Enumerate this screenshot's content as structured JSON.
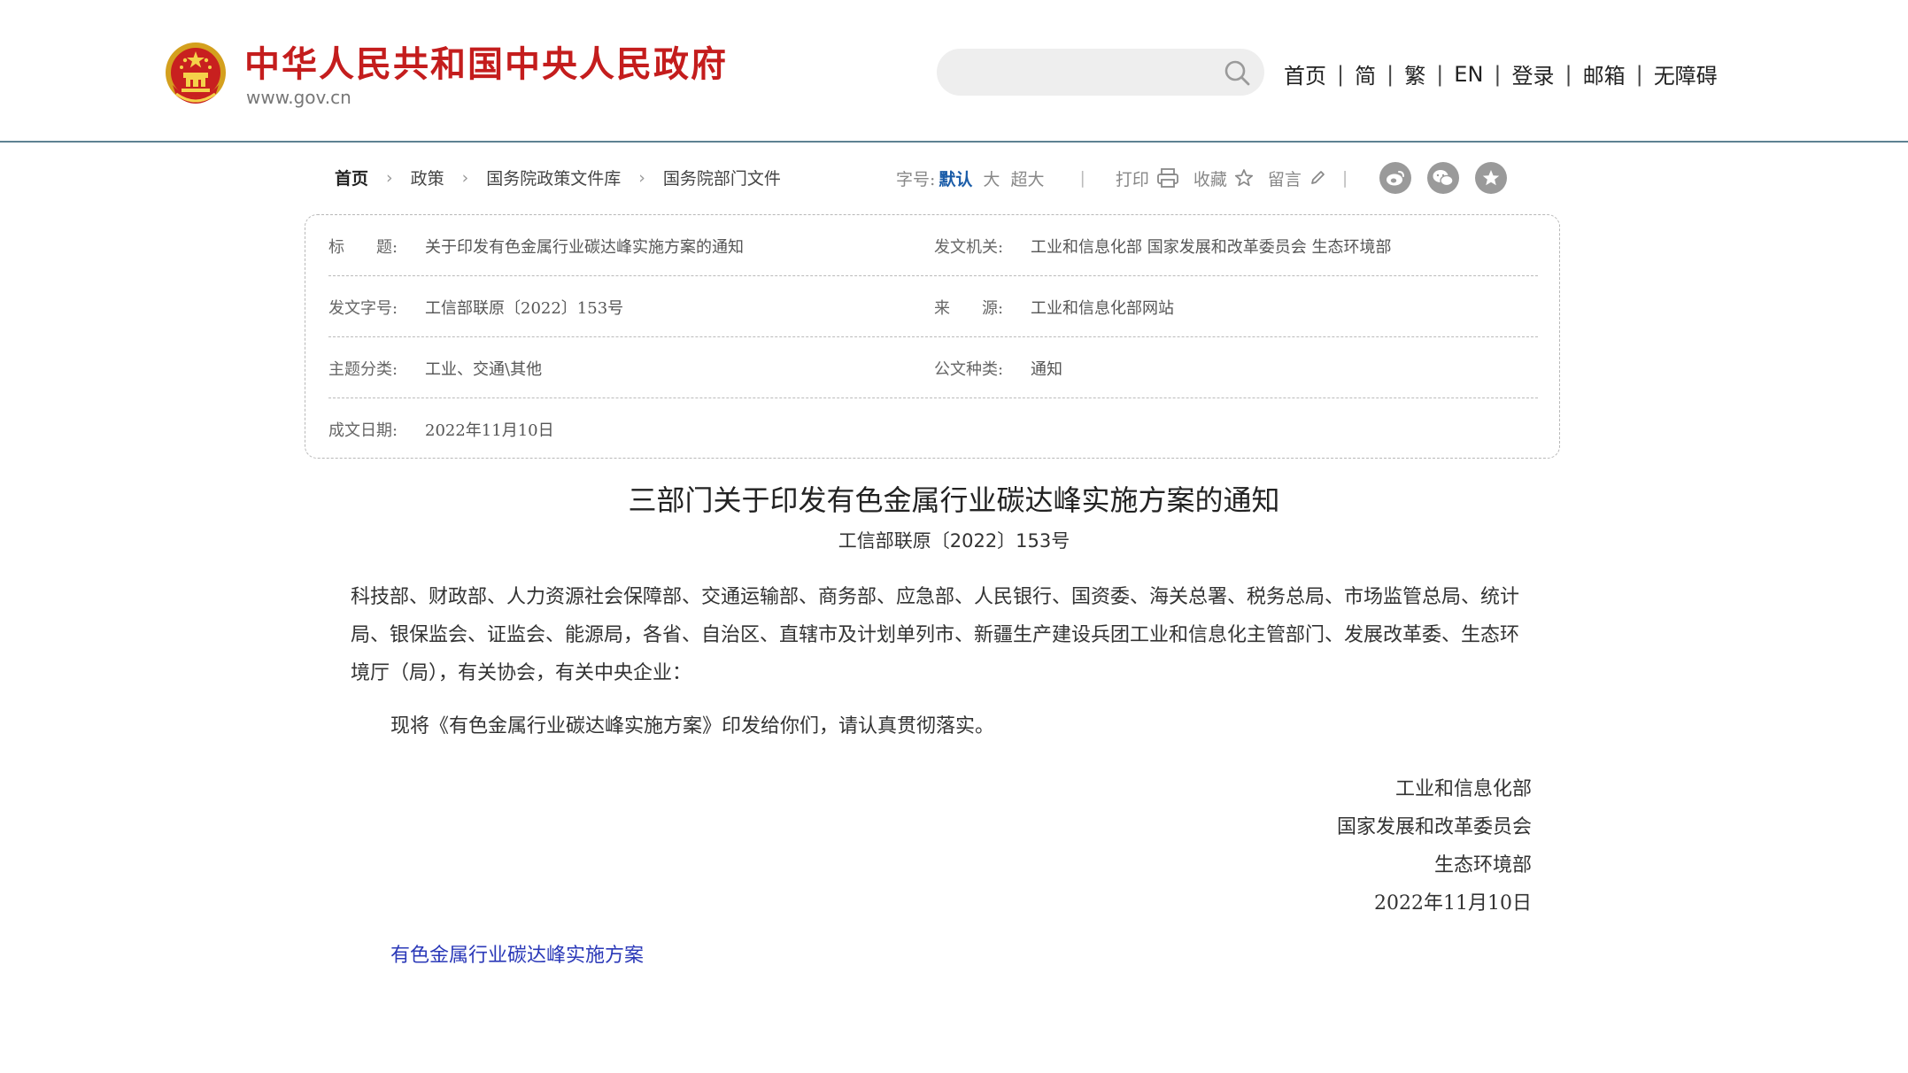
{
  "header": {
    "site_title": "中华人民共和国中央人民政府",
    "site_url": "www.gov.cn",
    "search": {
      "placeholder": ""
    },
    "nav": [
      "首页",
      "简",
      "繁",
      "EN",
      "登录",
      "邮箱",
      "无障碍"
    ]
  },
  "breadcrumb": [
    "首页",
    "政策",
    "国务院政策文件库",
    "国务院部门文件"
  ],
  "toolbar": {
    "font_size_label": "字号:",
    "font_sizes": [
      "默认",
      "大",
      "超大"
    ],
    "print_label": "打印",
    "favorite_label": "收藏",
    "comment_label": "留言"
  },
  "info": {
    "title_key": "标　　题:",
    "title_value": "关于印发有色金属行业碳达峰实施方案的通知",
    "issuer_key": "发文机关:",
    "issuer_value": "工业和信息化部 国家发展和改革委员会 生态环境部",
    "docno_key": "发文字号:",
    "docno_value": "工信部联原〔2022〕153号",
    "source_key": "来　　源:",
    "source_value": "工业和信息化部网站",
    "category_key": "主题分类:",
    "category_value": "工业、交通\\其他",
    "doctype_key": "公文种类:",
    "doctype_value": "通知",
    "date_key": "成文日期:",
    "date_value": "2022年11月10日"
  },
  "article": {
    "title": "三部门关于印发有色金属行业碳达峰实施方案的通知",
    "doc_number": "工信部联原〔2022〕153号",
    "recipients": "科技部、财政部、人力资源社会保障部、交通运输部、商务部、应急部、人民银行、国资委、海关总署、税务总局、市场监管总局、统计局、银保监会、证监会、能源局，各省、自治区、直辖市及计划单列市、新疆生产建设兵团工业和信息化主管部门、发展改革委、生态环境厅（局），有关协会，有关中央企业：",
    "body": "现将《有色金属行业碳达峰实施方案》印发给你们，请认真贯彻落实。",
    "signatures": [
      "工业和信息化部",
      "国家发展和改革委员会",
      "生态环境部",
      "2022年11月10日"
    ],
    "attachment_link": "有色金属行业碳达峰实施方案"
  },
  "colors": {
    "brand_red": "#c41d1d",
    "active_blue": "#1a5ca8",
    "link_blue": "#2b39b8",
    "header_rule": "#5e8292"
  }
}
